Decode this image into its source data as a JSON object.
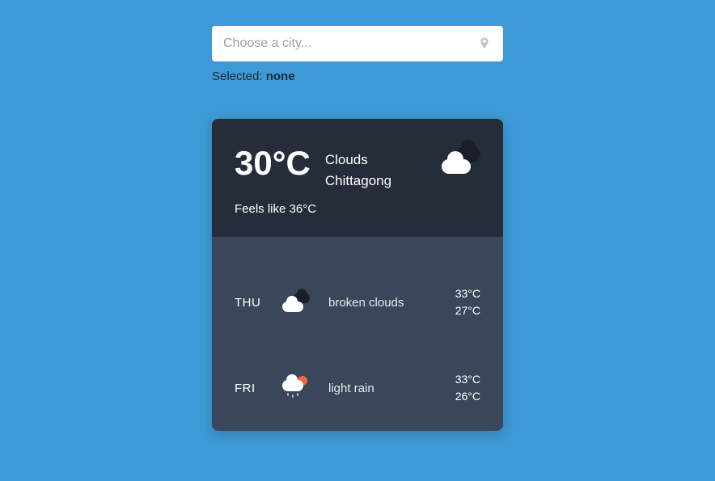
{
  "search": {
    "placeholder": "Choose a city...",
    "value": ""
  },
  "selected": {
    "label": "Selected: ",
    "value": "none"
  },
  "current": {
    "temp": "30°C",
    "condition": "Clouds",
    "city": "Chittagong",
    "feels_like_label": "Feels like 36°C"
  },
  "forecast": [
    {
      "day": "THU",
      "icon": "clouds",
      "desc": "broken clouds",
      "high": "33°C",
      "low": "27°C"
    },
    {
      "day": "FRI",
      "icon": "rain-sun",
      "desc": "light rain",
      "high": "33°C",
      "low": "26°C"
    }
  ]
}
